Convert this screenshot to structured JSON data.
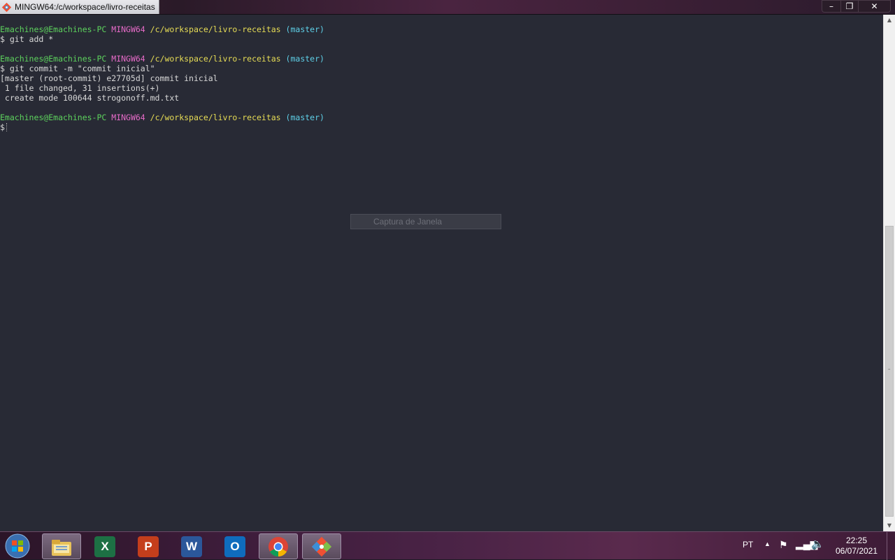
{
  "window": {
    "title": "MINGW64:/c/workspace/livro-receitas",
    "minimize_label": "–",
    "maximize_label": "❐",
    "close_label": "✕"
  },
  "terminal": {
    "prompt": {
      "user": "Emachines@Emachines-PC",
      "system": "MINGW64",
      "path": "/c/workspace/livro-receitas",
      "branch": "(master)"
    },
    "lines": [
      {
        "type": "prompt"
      },
      {
        "type": "text",
        "text": "$ git add *"
      },
      {
        "type": "blank"
      },
      {
        "type": "prompt"
      },
      {
        "type": "text",
        "text": "$ git commit -m \"commit inicial\""
      },
      {
        "type": "text",
        "text": "[master (root-commit) e27705d] commit inicial"
      },
      {
        "type": "text",
        "text": " 1 file changed, 31 insertions(+)"
      },
      {
        "type": "text",
        "text": " create mode 100644 strogonoff.md.txt"
      },
      {
        "type": "blank"
      },
      {
        "type": "prompt"
      },
      {
        "type": "cursor",
        "text": "$"
      }
    ],
    "colors": {
      "user": "#5dd35d",
      "system": "#e66bc8",
      "path": "#e7dd55",
      "branch": "#5ed0e8",
      "background": "#282a35"
    }
  },
  "overlay": {
    "capture_label": "Captura de Janela"
  },
  "taskbar": {
    "apps": [
      {
        "name": "explorer-icon",
        "label": "",
        "active": true
      },
      {
        "name": "excel-icon",
        "label": "X",
        "active": false,
        "color": "#1d7044"
      },
      {
        "name": "powerpoint-icon",
        "label": "P",
        "active": false,
        "color": "#c43e1c"
      },
      {
        "name": "word-icon",
        "label": "W",
        "active": false,
        "color": "#2b579a"
      },
      {
        "name": "outlook-icon",
        "label": "O",
        "active": false,
        "color": "#0f6cbd"
      },
      {
        "name": "chrome-icon",
        "label": "",
        "active": true
      },
      {
        "name": "git-icon",
        "label": "",
        "active": true
      }
    ],
    "language": "PT",
    "time": "22:25",
    "date": "06/07/2021"
  }
}
